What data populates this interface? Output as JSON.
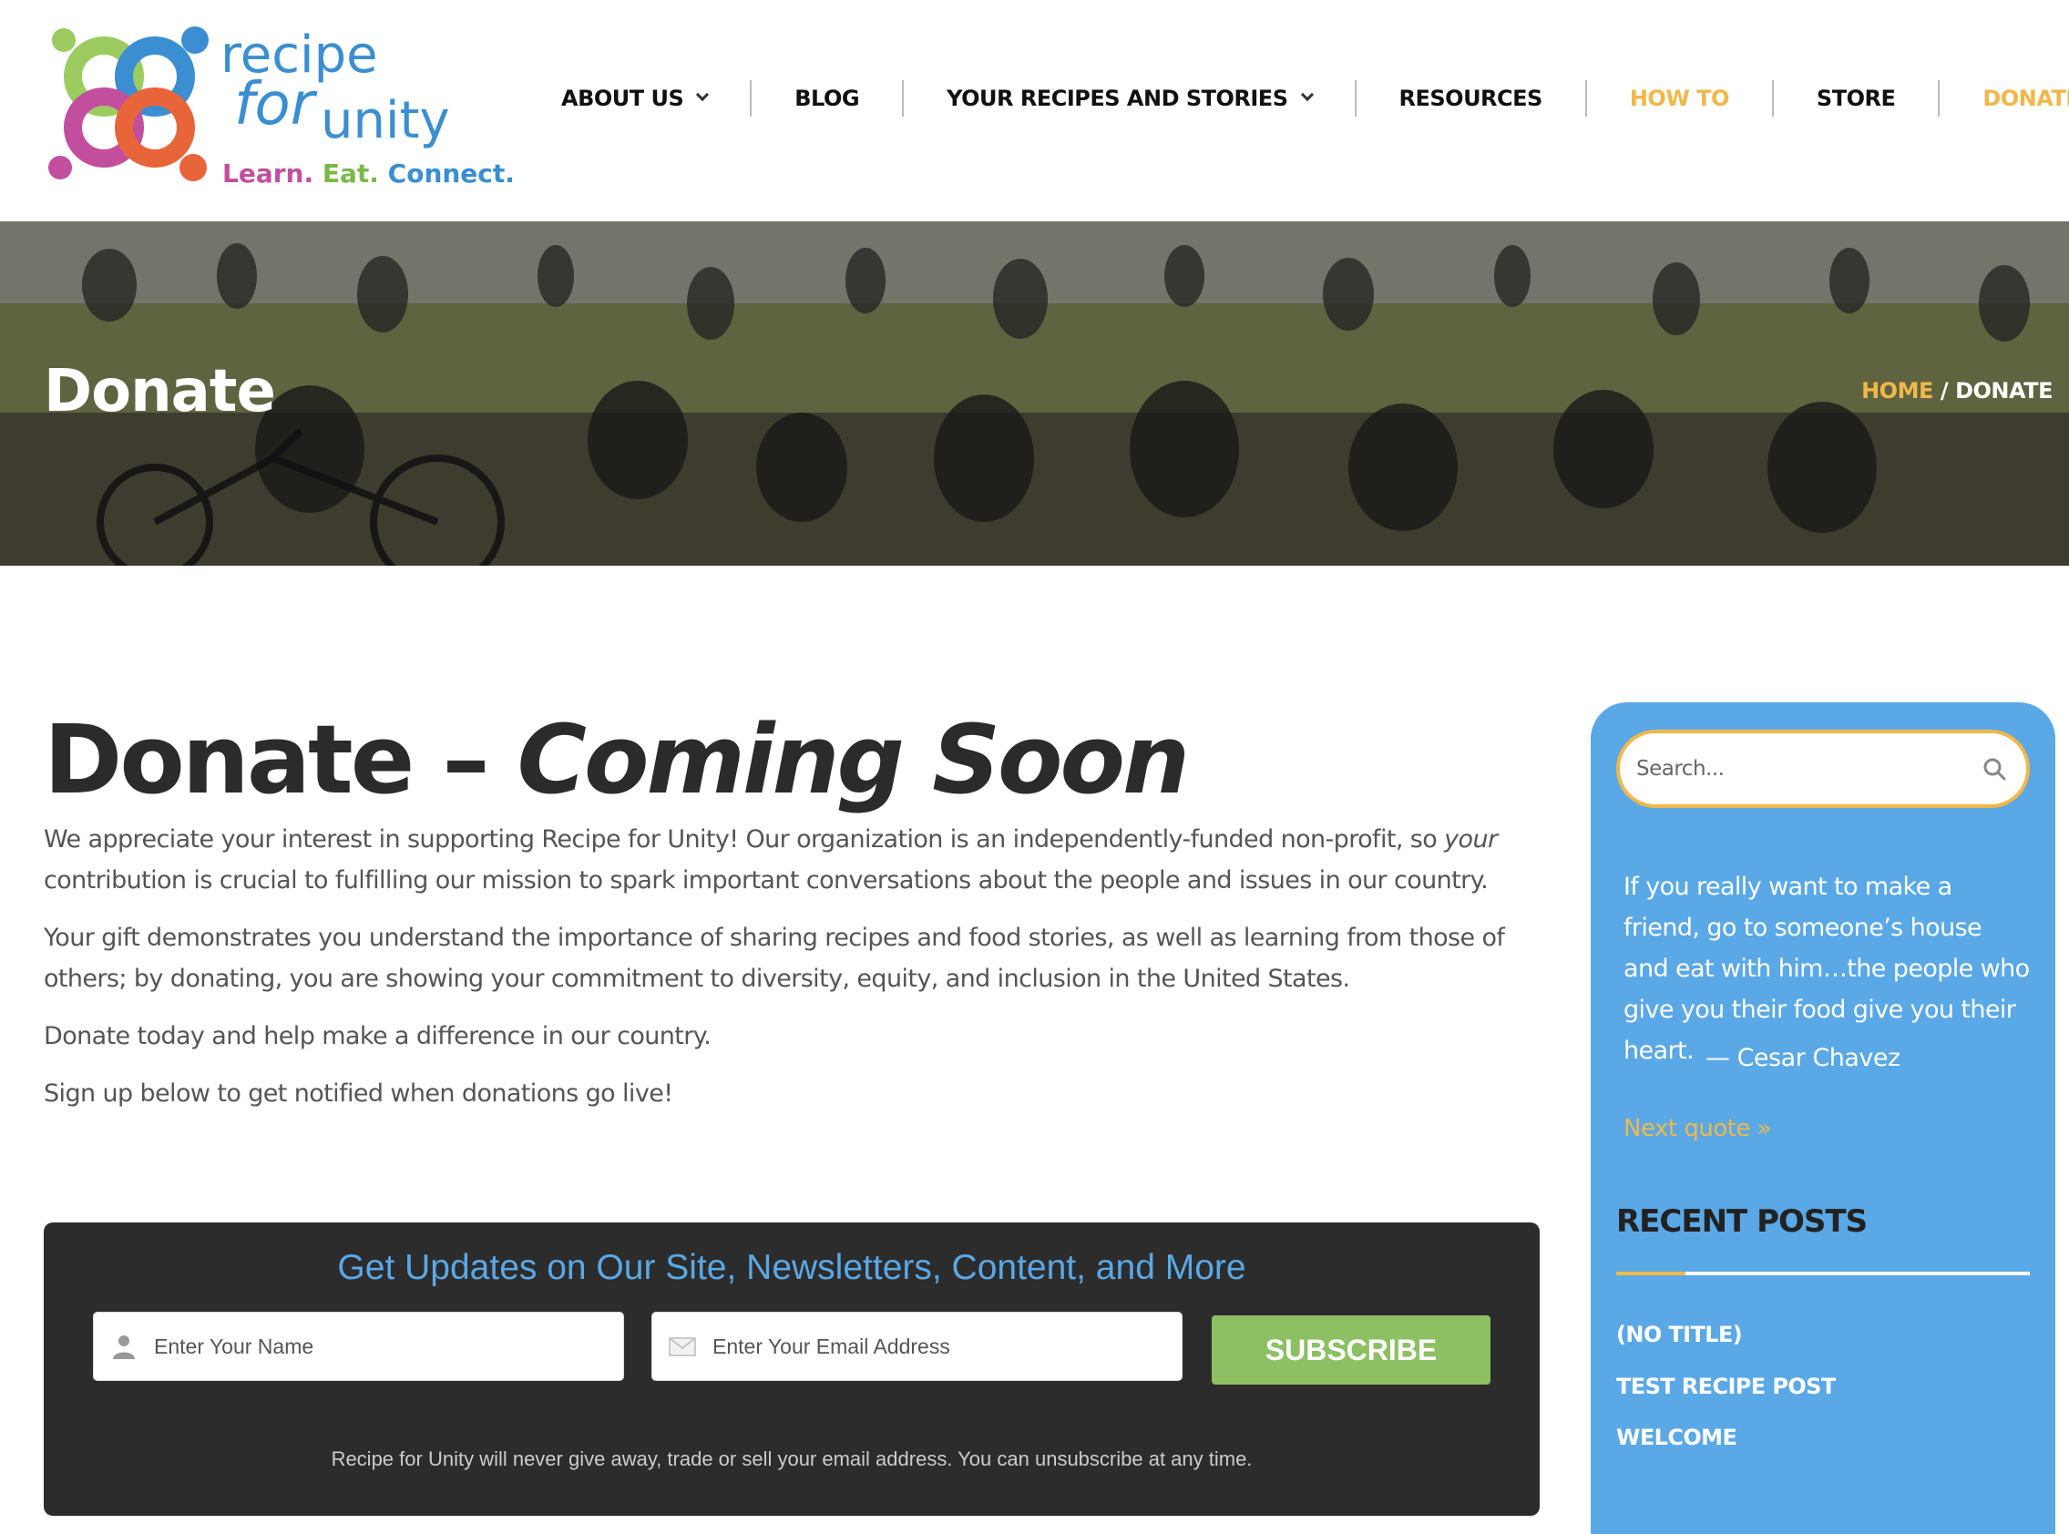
{
  "brand": {
    "logo_line1": "recipe",
    "logo_line2": "for",
    "logo_line3": "unity",
    "tagline_1": "Learn.",
    "tagline_2": "Eat.",
    "tagline_3": "Connect."
  },
  "nav": {
    "items": [
      {
        "label": "ABOUT US",
        "dropdown": true
      },
      {
        "label": "BLOG"
      },
      {
        "label": "YOUR RECIPES AND STORIES",
        "dropdown": true
      },
      {
        "label": "RESOURCES"
      },
      {
        "label": "HOW TO"
      },
      {
        "label": "STORE"
      },
      {
        "label": "DONATE"
      }
    ]
  },
  "hero": {
    "title": "Donate",
    "breadcrumb_home": "HOME",
    "breadcrumb_sep": "/",
    "breadcrumb_current": "DONATE"
  },
  "main": {
    "title_plain": "Donate – ",
    "title_italic": "Coming Soon",
    "p1_a": "We appreciate your interest in supporting Recipe for Unity! Our organization is an independently-funded non-profit, so ",
    "p1_em": "your",
    "p1_b": " contribution is crucial to fulfilling our mission to spark important conversations about the people and issues in our country.",
    "p2": "Your gift demonstrates you understand the importance of sharing recipes and food stories, as well as learning from those of others; by donating, you are showing your commitment to diversity, equity, and inclusion in the United States.",
    "p3": "Donate today and help make a difference in our country.",
    "p4": "Sign up below to get notified when donations go live!"
  },
  "subscribe": {
    "title": "Get Updates on Our Site, Newsletters, Content, and More",
    "name_placeholder": "Enter Your Name",
    "email_placeholder": "Enter Your Email Address",
    "button": "SUBSCRIBE",
    "note": "Recipe for Unity will never give away, trade or sell your email address. You can unsubscribe at any time."
  },
  "sidebar": {
    "search_placeholder": "Search...",
    "quote": "If you really want to make a friend, go to someone’s house and eat with him…the people who give you their food give you their heart.",
    "quote_author": "— Cesar Chavez",
    "next_quote": "Next quote »",
    "recent_posts_title": "RECENT POSTS",
    "recent_posts": [
      "(NO TITLE)",
      "TEST RECIPE POST",
      "WELCOME"
    ]
  },
  "colors": {
    "accent_gold": "#f0b84a",
    "sidebar_blue": "#5aa8e6",
    "subscribe_green": "#8cc063",
    "dark_box": "#2c2c2c"
  }
}
